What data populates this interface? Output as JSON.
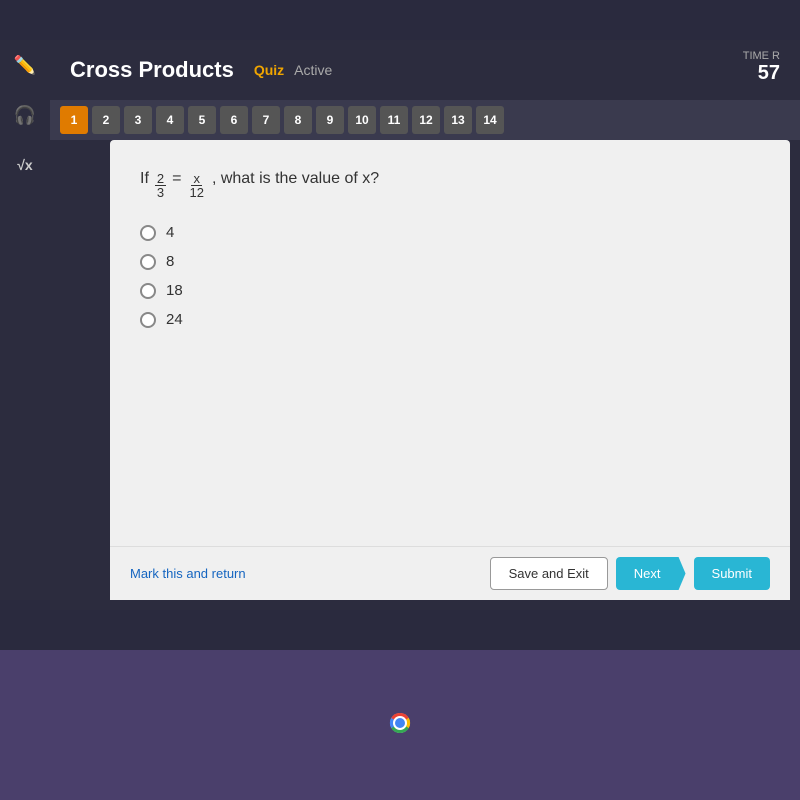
{
  "header": {
    "title": "Cross Products",
    "quiz_label": "Quiz",
    "active_label": "Active",
    "timer_label": "TIME R",
    "timer_value": "57"
  },
  "question_numbers": [
    1,
    2,
    3,
    4,
    5,
    6,
    7,
    8,
    9,
    10,
    11,
    12,
    13,
    14
  ],
  "active_question": 1,
  "question": {
    "text_prefix": "If",
    "fraction1_num": "2",
    "fraction1_den": "3",
    "equals": "=",
    "fraction2_num": "x",
    "fraction2_den": "12",
    "text_suffix": ", what is the value of x?"
  },
  "options": [
    {
      "value": "4"
    },
    {
      "value": "8"
    },
    {
      "value": "18"
    },
    {
      "value": "24"
    }
  ],
  "footer": {
    "mark_link": "Mark this and return",
    "save_exit_btn": "Save and Exit",
    "next_btn": "Next",
    "submit_btn": "Submit"
  },
  "sidebar": {
    "icons": [
      "✏️",
      "🎧",
      "√x"
    ]
  }
}
